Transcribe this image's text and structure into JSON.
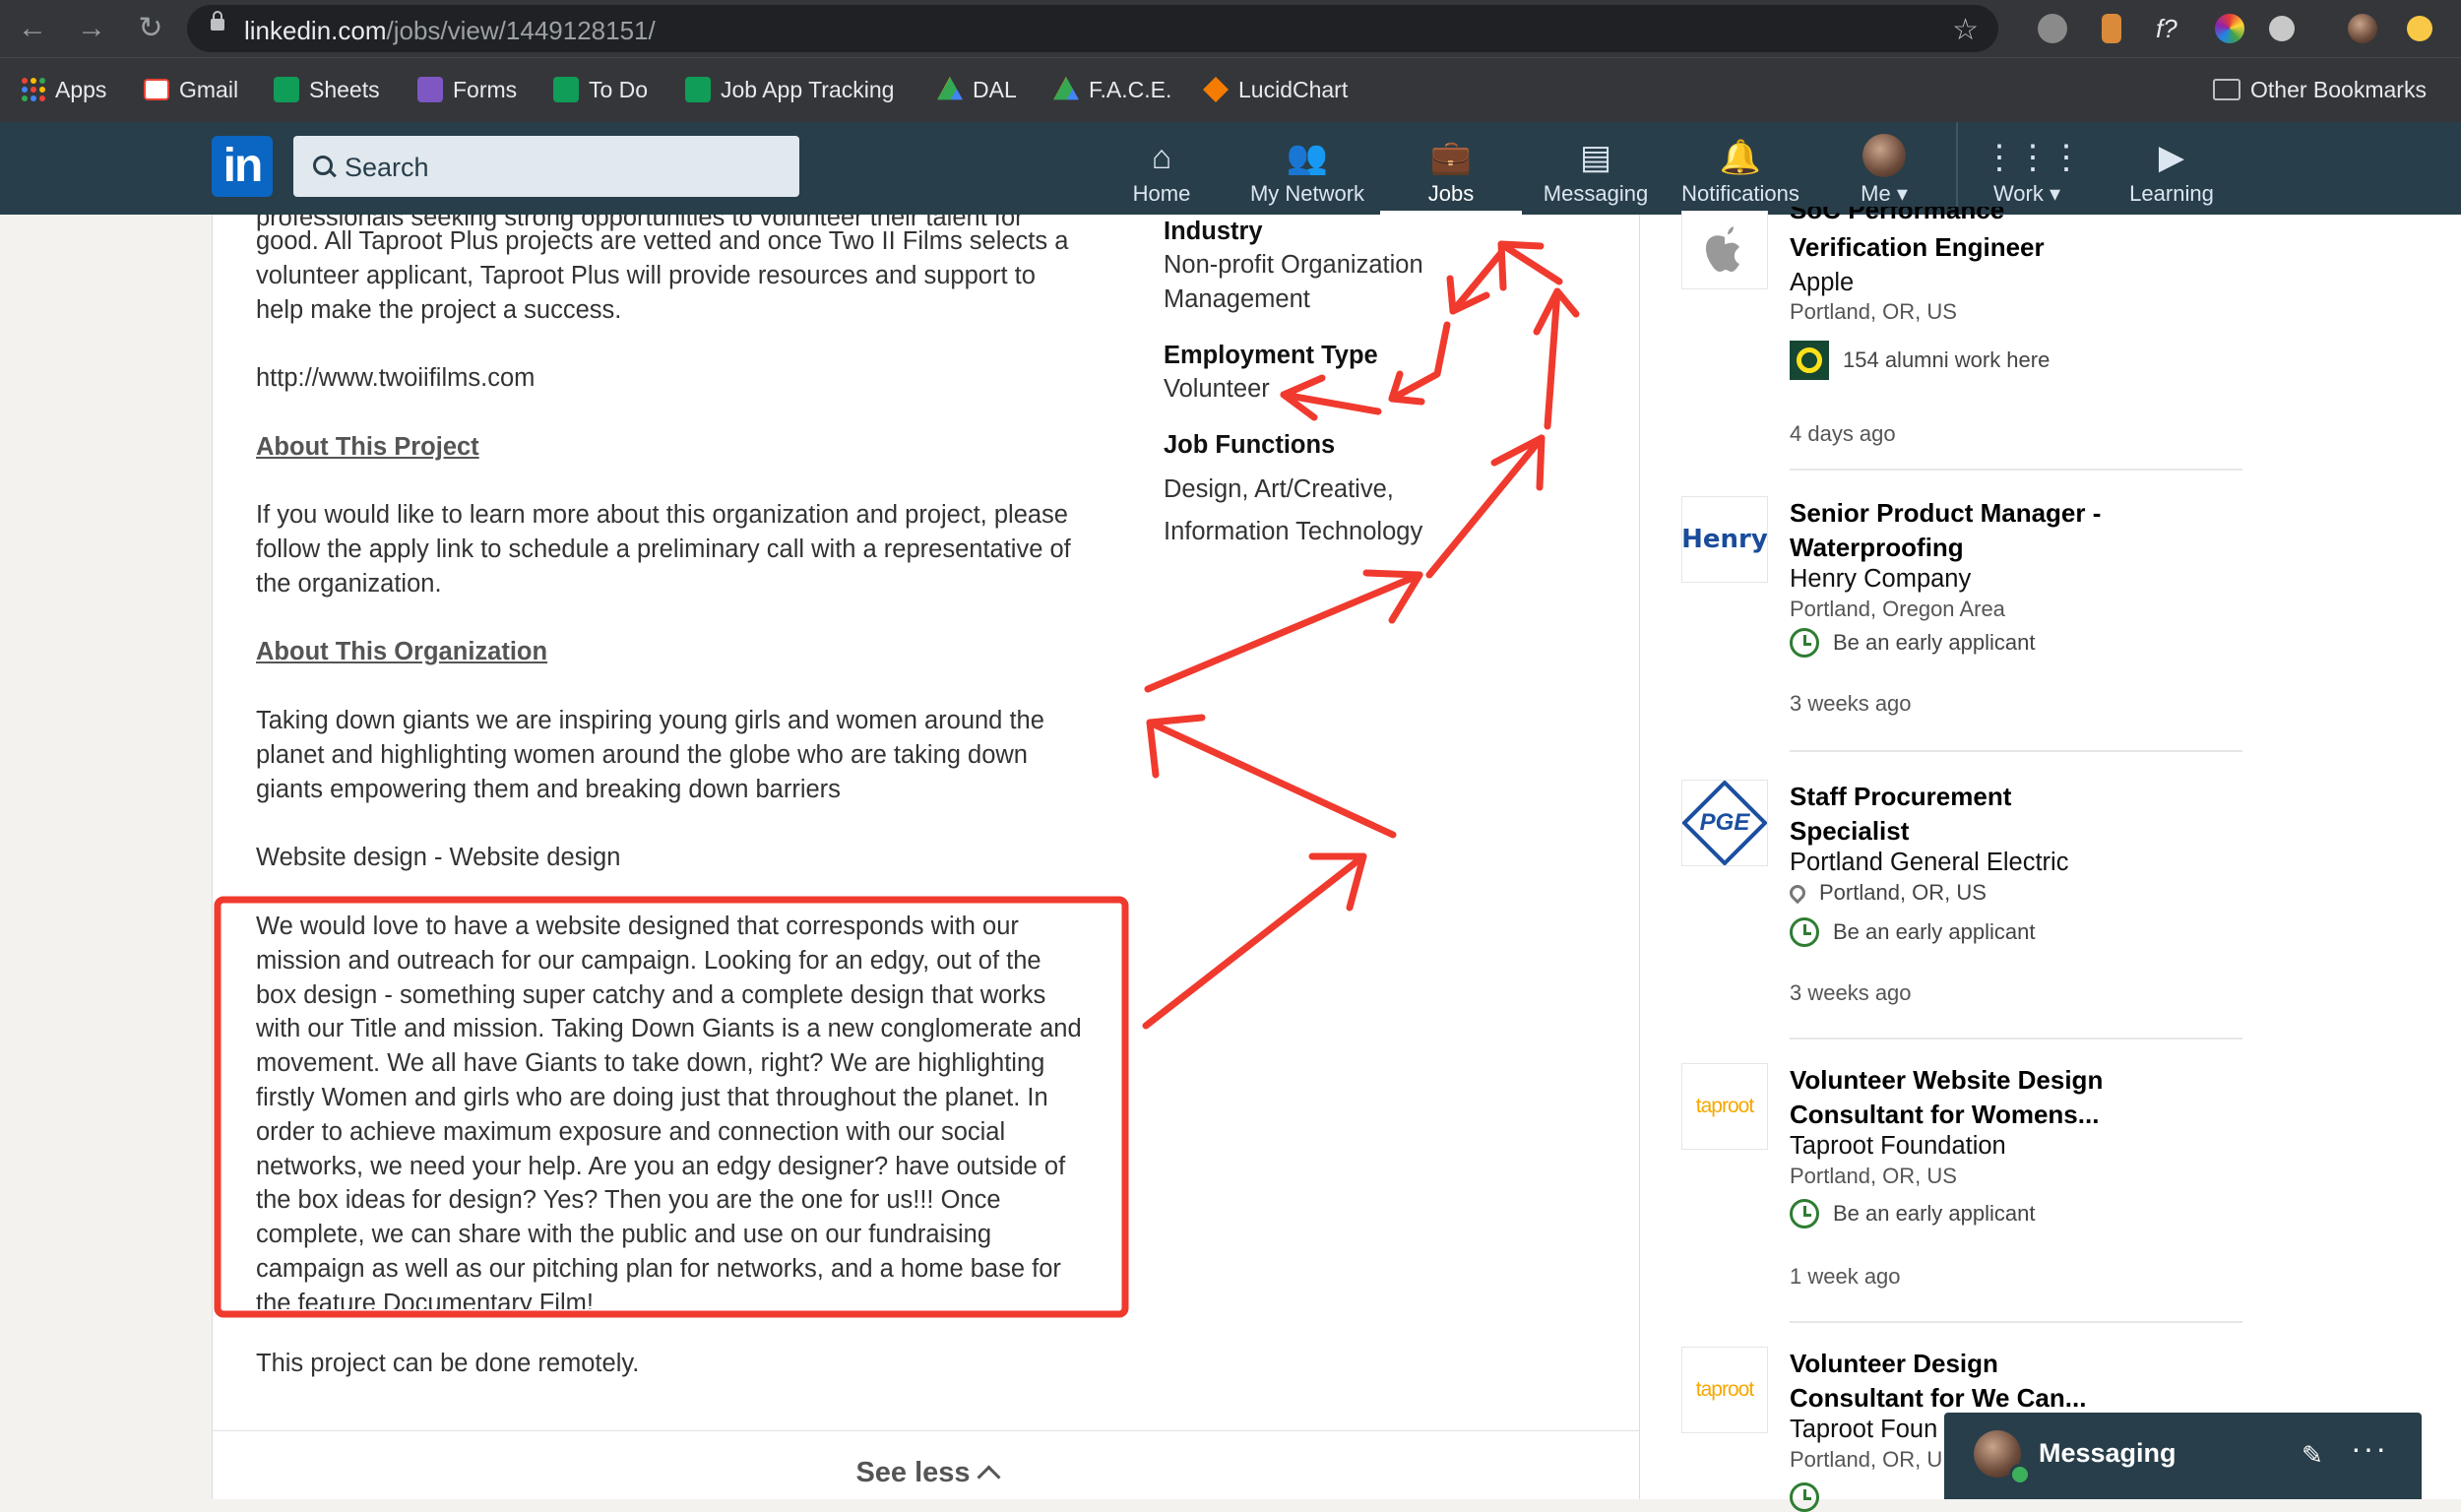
{
  "browser": {
    "url_host": "linkedin.com",
    "url_path": "/jobs/view/1449128151/",
    "bookmarks": [
      {
        "label": "Apps",
        "icon": "apps-grid-icon"
      },
      {
        "label": "Gmail",
        "icon": "gmail-icon"
      },
      {
        "label": "Sheets",
        "icon": "sheets-icon"
      },
      {
        "label": "Forms",
        "icon": "forms-icon"
      },
      {
        "label": "To Do",
        "icon": "sheets-icon"
      },
      {
        "label": "Job App Tracking",
        "icon": "sheets-icon"
      },
      {
        "label": "DAL",
        "icon": "drive-icon"
      },
      {
        "label": "F.A.C.E.",
        "icon": "drive-icon"
      },
      {
        "label": "LucidChart",
        "icon": "lucidchart-icon"
      }
    ],
    "other_bookmarks": "Other Bookmarks"
  },
  "linkedin": {
    "logo": "in",
    "search_placeholder": "Search",
    "nav": [
      {
        "label": "Home",
        "icon": "home-icon"
      },
      {
        "label": "My Network",
        "icon": "network-icon"
      },
      {
        "label": "Jobs",
        "icon": "briefcase-icon",
        "active": true
      },
      {
        "label": "Messaging",
        "icon": "messaging-icon"
      },
      {
        "label": "Notifications",
        "icon": "bell-icon"
      },
      {
        "label": "Me",
        "icon": "avatar"
      },
      {
        "label": "Work",
        "icon": "grid-icon"
      },
      {
        "label": "Learning",
        "icon": "learning-icon"
      }
    ]
  },
  "description": {
    "cut_line": "professionals seeking strong opportunities to volunteer their talent for",
    "p1": [
      "good. All Taproot Plus projects are vetted and once Two II Films selects a",
      "volunteer applicant, Taproot Plus will provide resources and support to",
      "help make the project a success."
    ],
    "link": "http://www.twoiifilms.com",
    "about_project_heading": "About This Project",
    "p2": [
      "If you would like to learn more about this organization and project, please",
      "follow the apply link to schedule a preliminary call with a representative of",
      "the organization."
    ],
    "about_org_heading": "About This Organization",
    "p3": [
      "Taking down giants we are inspiring young girls and women around the",
      "planet and highlighting women around the globe who are taking down",
      "giants empowering them and breaking down barriers"
    ],
    "p4": "Website design - Website design",
    "p5": [
      "We would love to have a website designed that corresponds with our",
      "mission and outreach for our campaign. Looking for an edgy, out of the",
      "box design - something super catchy and a complete design that works",
      "with our Title and mission. Taking Down Giants is a new conglomerate and",
      "movement. We all have Giants to take down, right? We are highlighting",
      "firstly Women and girls who are doing just that throughout the planet. In",
      "order to achieve maximum exposure and connection with our social",
      "networks, we need your help. Are you an edgy designer? have outside of",
      "the box ideas for design? Yes? Then you are the one for us!!! Once",
      "complete, we can share with the public and use on our fundraising",
      "campaign as well as our pitching plan for networks, and a home base for",
      "the feature Documentary Film!"
    ],
    "p6": "This project can be done remotely.",
    "see_less": "See less"
  },
  "criteria": {
    "industry_heading": "Industry",
    "industry_lines": [
      "Non-profit Organization",
      "Management"
    ],
    "employment_heading": "Employment Type",
    "employment_value": "Volunteer",
    "functions_heading": "Job Functions",
    "functions_lines": [
      "Design, Art/Creative,",
      "Information Technology"
    ]
  },
  "rail": {
    "jobs": [
      {
        "title": [
          "SoC Performance",
          "Verification Engineer"
        ],
        "company": "Apple",
        "location": "Portland, OR, US",
        "badge": "154 alumni work here",
        "time": "4 days ago",
        "logo": "apple-logo-icon"
      },
      {
        "title": [
          "Senior Product Manager -",
          "Waterproofing"
        ],
        "company": "Henry Company",
        "location": "Portland, Oregon Area",
        "badge": "Be an early applicant",
        "time": "3 weeks ago",
        "logo_text": "Henry"
      },
      {
        "title": [
          "Staff Procurement",
          "Specialist"
        ],
        "company": "Portland General Electric",
        "location": "Portland, OR, US",
        "badge": "Be an early applicant",
        "time": "3 weeks ago",
        "logo_text": "PGE"
      },
      {
        "title": [
          "Volunteer Website Design",
          "Consultant for Womens..."
        ],
        "company": "Taproot Foundation",
        "location": "Portland, OR, US",
        "badge": "Be an early applicant",
        "time": "1 week ago",
        "logo_text": "taproot"
      },
      {
        "title": [
          "Volunteer Design",
          "Consultant for We Can..."
        ],
        "company": "Taproot Foun",
        "location": "Portland, OR, U",
        "logo_text": "taproot"
      }
    ]
  },
  "messaging": {
    "label": "Messaging"
  },
  "colors": {
    "annotation": "#f03a2e",
    "nav_bg": "#283e4a",
    "linkedin_blue": "#0a66c2"
  }
}
